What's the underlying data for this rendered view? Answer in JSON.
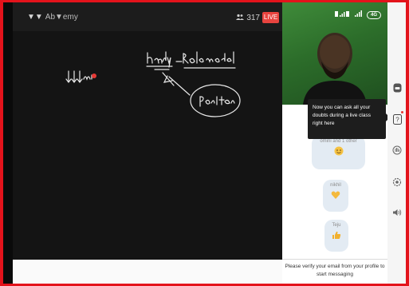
{
  "header": {
    "brand_logo": "▼▼",
    "brand_name": "Ab▼emy",
    "viewer_count": "317",
    "live_label": "LIVE"
  },
  "board": {
    "handwriting": [
      "↓↓↓mi",
      "Hardy",
      "Role model",
      "Positive"
    ]
  },
  "video": {
    "status_label": "4G"
  },
  "tooltip": {
    "text": "Now you can ask all your doubts during a live class right here"
  },
  "chat": {
    "messages": [
      {
        "name": "omini and 1 other",
        "emoji": "smile-face"
      },
      {
        "name": "nikhil",
        "emoji": "heart-hands"
      },
      {
        "name": "Teju",
        "emoji": "thumbs-up"
      }
    ],
    "verify_line1": "Please verify your email from your profile to",
    "verify_line2": "start messaging"
  },
  "rail": {
    "icons": [
      "chat-icon",
      "doubt-icon",
      "hand-icon",
      "settings-icon",
      "volume-icon"
    ]
  },
  "colors": {
    "frame_border": "#e3131b",
    "live_badge": "#e8443f",
    "chat_bubble": "#e3ebf3",
    "board_bg": "#141414"
  }
}
